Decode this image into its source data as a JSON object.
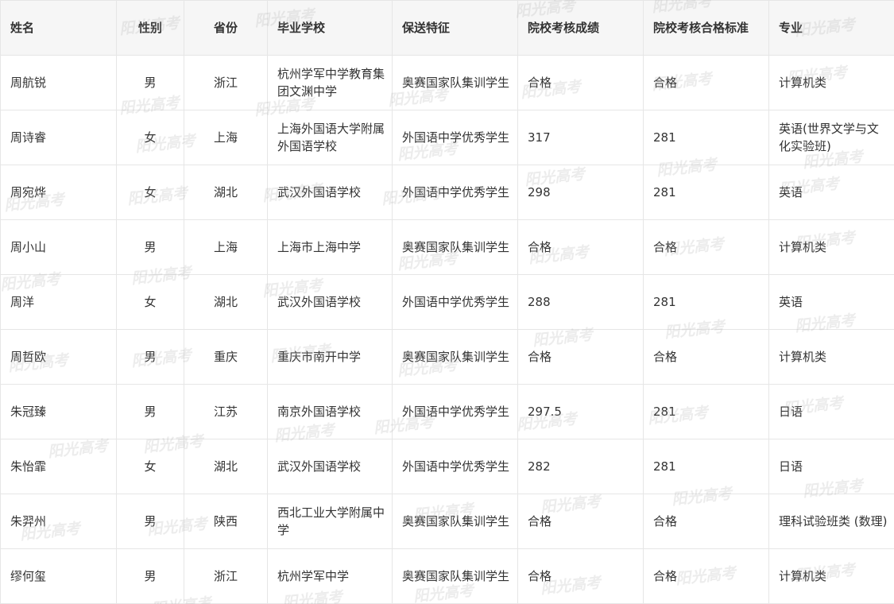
{
  "table": {
    "headers": [
      "姓名",
      "性别",
      "省份",
      "毕业学校",
      "保送特征",
      "院校考核成绩",
      "院校考核合格标准",
      "专业"
    ],
    "rows": [
      [
        "周航锐",
        "男",
        "浙江",
        "杭州学军中学教育集团文渊中学",
        "奥赛国家队集训学生",
        "合格",
        "合格",
        "计算机类"
      ],
      [
        "周诗睿",
        "女",
        "上海",
        "上海外国语大学附属外国语学校",
        "外国语中学优秀学生",
        "317",
        "281",
        "英语(世界文学与文化实验班)"
      ],
      [
        "周宛烨",
        "女",
        "湖北",
        "武汉外国语学校",
        "外国语中学优秀学生",
        "298",
        "281",
        "英语"
      ],
      [
        "周小山",
        "男",
        "上海",
        "上海市上海中学",
        "奥赛国家队集训学生",
        "合格",
        "合格",
        "计算机类"
      ],
      [
        "周洋",
        "女",
        "湖北",
        "武汉外国语学校",
        "外国语中学优秀学生",
        "288",
        "281",
        "英语"
      ],
      [
        "周哲欧",
        "男",
        "重庆",
        "重庆市南开中学",
        "奥赛国家队集训学生",
        "合格",
        "合格",
        "计算机类"
      ],
      [
        "朱冠臻",
        "男",
        "江苏",
        "南京外国语学校",
        "外国语中学优秀学生",
        "297.5",
        "281",
        "日语"
      ],
      [
        "朱怡霏",
        "女",
        "湖北",
        "武汉外国语学校",
        "外国语中学优秀学生",
        "282",
        "281",
        "日语"
      ],
      [
        "朱羿州",
        "男",
        "陕西",
        "西北工业大学附属中学",
        "奥赛国家队集训学生",
        "合格",
        "合格",
        "理科试验班类 (数理)"
      ],
      [
        "缪何玺",
        "男",
        "浙江",
        "杭州学军中学",
        "奥赛国家队集训学生",
        "合格",
        "合格",
        "计算机类"
      ]
    ]
  },
  "watermark": {
    "text": "阳光高考"
  }
}
